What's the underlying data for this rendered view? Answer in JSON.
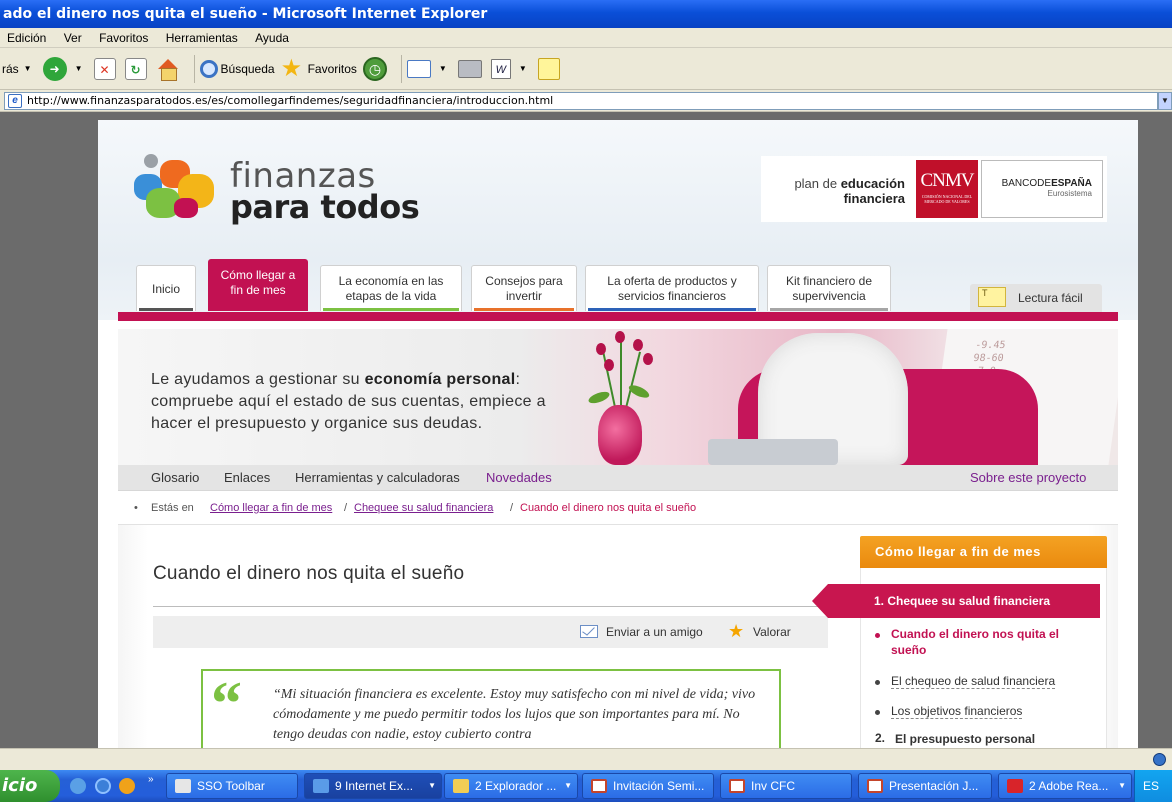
{
  "window": {
    "title": "ado el dinero nos quita el sueño - Microsoft Internet Explorer"
  },
  "menubar": [
    "Edición",
    "Ver",
    "Favoritos",
    "Herramientas",
    "Ayuda"
  ],
  "toolbar": {
    "back_label": "rás",
    "search_label": "Búsqueda",
    "favorites_label": "Favoritos"
  },
  "address": {
    "url": "http://www.finanzasparatodos.es/es/comollegarfindemes/seguridadfinanciera/introduccion.html"
  },
  "site": {
    "logo_line1": "finanzas",
    "logo_line2": "para todos",
    "plan_line1_a": "plan de ",
    "plan_line1_b": "educación",
    "plan_line2": "financiera",
    "cnmv": "CNMV",
    "cnmv_small": "COMISIÓN NACIONAL DEL MERCADO DE VALORES",
    "bde_a": "BANCO",
    "bde_b": "DE",
    "bde_c": "ESPAÑA",
    "bde_small": "Eurosistema"
  },
  "nav": {
    "tabs": [
      {
        "line1": "Inicio",
        "line2": "",
        "color": "#555555"
      },
      {
        "line1": "Cómo llegar a",
        "line2": "fin de mes",
        "color": "#c21152"
      },
      {
        "line1": "La economía en las",
        "line2": "etapas de la vida",
        "color": "#7cc142"
      },
      {
        "line1": "Consejos para",
        "line2": "invertir",
        "color": "#e8712a"
      },
      {
        "line1": "La oferta de productos y",
        "line2": "servicios financieros",
        "color": "#2d62b8"
      },
      {
        "line1": "Kit financiero de",
        "line2": "supervivencia",
        "color": "#a6a6a6"
      }
    ],
    "lectura": "Lectura fácil"
  },
  "banner": {
    "text_a": "Le ayudamos a gestionar su ",
    "text_b": "economía personal",
    "text_c": ": compruebe aquí el estado de sus cuentas, empiece a hacer el presupuesto y organice sus deudas."
  },
  "subnav": {
    "items": [
      "Glosario",
      "Enlaces",
      "Herramientas y calculadoras",
      "Novedades"
    ],
    "right": "Sobre este proyecto"
  },
  "breadcrumb": {
    "label": "Estás en",
    "crumb1": "Cómo llegar a fin de mes",
    "crumb2": "Chequee su salud financiera",
    "current": "Cuando el dinero nos quita el sueño"
  },
  "article": {
    "title": "Cuando el dinero nos quita el sueño",
    "send_friend": "Enviar a un amigo",
    "rate": "Valorar",
    "quote_mark": "“",
    "quote": "“Mi situación financiera es excelente. Estoy muy satisfecho con mi nivel de vida; vivo cómodamente y me puedo permitir todos los lujos que son importantes para mí. No tengo deudas con nadie, estoy cubierto contra"
  },
  "sidebar": {
    "heading": "Cómo llegar a fin de mes",
    "active": "1.  Chequee su salud financiera",
    "current": "Cuando el dinero nos quita el sueño",
    "item2": "El chequeo de salud financiera",
    "item3": "Los objetivos financieros",
    "num2": "2.",
    "next": "El presupuesto personal"
  },
  "taskbar": {
    "start": "icio",
    "buttons": [
      {
        "label": "SSO Toolbar",
        "icon_color": "#e6e6e6"
      },
      {
        "label": "9 Internet Ex...",
        "icon_color": "#5a9be8"
      },
      {
        "label": "2 Explorador ...",
        "icon_color": "#f1cd55"
      },
      {
        "label": "Invitación Semi...",
        "icon_color": "#ffffff"
      },
      {
        "label": "Inv CFC",
        "icon_color": "#ffffff"
      },
      {
        "label": "Presentación J...",
        "icon_color": "#ffffff"
      },
      {
        "label": "2 Adobe Rea...",
        "icon_color": "#d8242a"
      }
    ],
    "lang": "ES"
  }
}
